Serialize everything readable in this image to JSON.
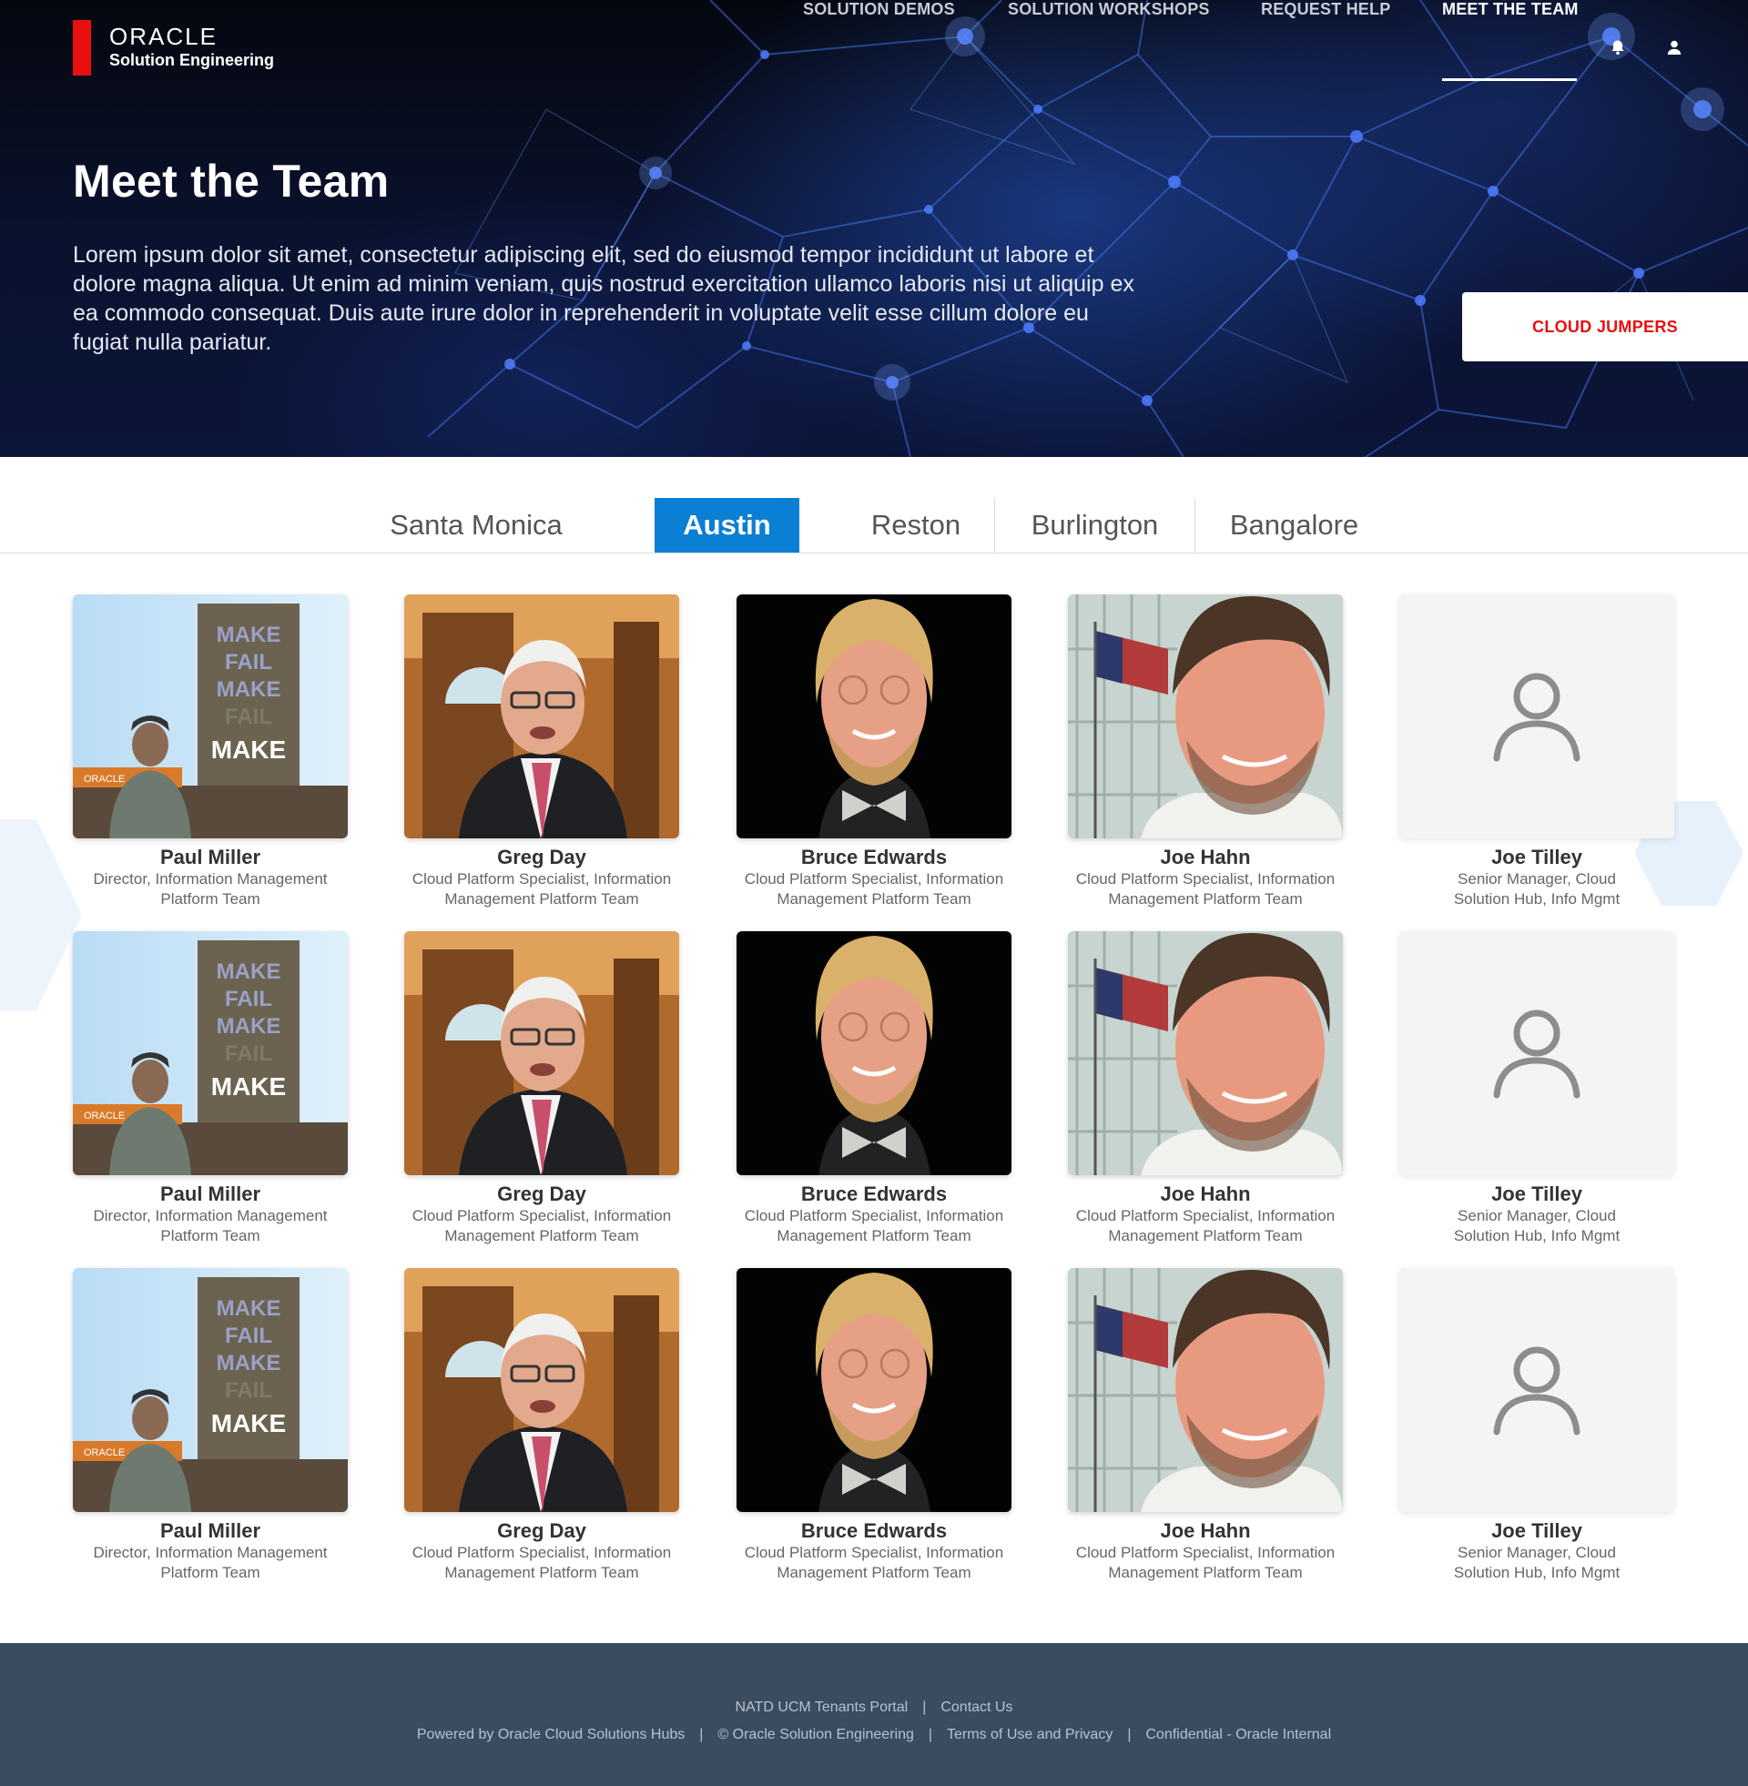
{
  "brand": {
    "name": "ORACLE",
    "subtitle": "Solution Engineering"
  },
  "nav": {
    "items": [
      {
        "label": "SOLUTION DEMOS",
        "active": false
      },
      {
        "label": "SOLUTION WORKSHOPS",
        "active": false
      },
      {
        "label": "REQUEST HELP",
        "active": false
      },
      {
        "label": "MEET THE TEAM",
        "active": true
      }
    ],
    "icons": [
      "bell-icon",
      "user-icon"
    ]
  },
  "hero": {
    "title": "Meet the Team",
    "description": "Lorem ipsum dolor sit amet, consectetur adipiscing elit, sed do eiusmod tempor incididunt ut labore et dolore magna aliqua. Ut enim ad minim veniam, quis nostrud exercitation ullamco laboris nisi ut aliquip ex ea commodo consequat. Duis aute irure dolor in reprehenderit in voluptate velit esse cillum dolore eu fugiat nulla pariatur.",
    "cta_label": "CLOUD JUMPERS"
  },
  "tabs": [
    {
      "label": "Santa Monica",
      "active": false
    },
    {
      "label": "Austin",
      "active": true
    },
    {
      "label": "Reston",
      "active": false
    },
    {
      "label": "Burlington",
      "active": false
    },
    {
      "label": "Bangalore",
      "active": false
    }
  ],
  "team": {
    "rows": [
      [
        {
          "name": "Paul Miller",
          "role": "Director, Information Management Platform Team",
          "photo": "presenter-stage"
        },
        {
          "name": "Greg Day",
          "role": "Cloud Platform Specialist, Information Management Platform Team",
          "photo": "man-white-hair-suit"
        },
        {
          "name": "Bruce Edwards",
          "role": "Cloud Platform Specialist, Information Management Platform Team",
          "photo": "man-glasses-bowtie"
        },
        {
          "name": "Joe Hahn",
          "role": "Cloud Platform Specialist, Information Management Platform Team",
          "photo": "man-selfie-flag"
        },
        {
          "name": "Joe Tilley",
          "role": "Senior Manager, Cloud Solution Hub, Info Mgmt",
          "photo": "placeholder"
        }
      ],
      [
        {
          "name": "Paul Miller",
          "role": "Director, Information Management Platform Team",
          "photo": "presenter-stage"
        },
        {
          "name": "Greg Day",
          "role": "Cloud Platform Specialist, Information Management Platform Team",
          "photo": "man-white-hair-suit"
        },
        {
          "name": "Bruce Edwards",
          "role": "Cloud Platform Specialist, Information Management Platform Team",
          "photo": "man-glasses-bowtie"
        },
        {
          "name": "Joe Hahn",
          "role": "Cloud Platform Specialist, Information Management Platform Team",
          "photo": "man-selfie-flag"
        },
        {
          "name": "Joe Tilley",
          "role": "Senior Manager, Cloud Solution Hub, Info Mgmt",
          "photo": "placeholder"
        }
      ],
      [
        {
          "name": "Paul Miller",
          "role": "Director, Information Management Platform Team",
          "photo": "presenter-stage"
        },
        {
          "name": "Greg Day",
          "role": "Cloud Platform Specialist, Information Management Platform Team",
          "photo": "man-white-hair-suit"
        },
        {
          "name": "Bruce Edwards",
          "role": "Cloud Platform Specialist, Information Management Platform Team",
          "photo": "man-glasses-bowtie"
        },
        {
          "name": "Joe Hahn",
          "role": "Cloud Platform Specialist, Information Management Platform Team",
          "photo": "man-selfie-flag"
        },
        {
          "name": "Joe Tilley",
          "role": "Senior Manager, Cloud Solution Hub, Info Mgmt",
          "photo": "placeholder"
        }
      ]
    ],
    "slide_text": [
      "MAKE",
      "FAIL",
      "MAKE",
      "FAIL",
      "MAKE"
    ],
    "slide_logo": "ORACLE"
  },
  "footer": {
    "row1": [
      "NATD UCM Tenants Portal",
      "Contact Us"
    ],
    "row2": [
      "Powered by Oracle Cloud Solutions Hubs",
      "© Oracle Solution Engineering",
      "Terms of Use and Privacy",
      "Confidential - Oracle Internal"
    ],
    "separator": "|"
  },
  "colors": {
    "accent_red": "#e8100f",
    "tab_active": "#0a7fd4",
    "footer_bg": "#3a4c60"
  }
}
